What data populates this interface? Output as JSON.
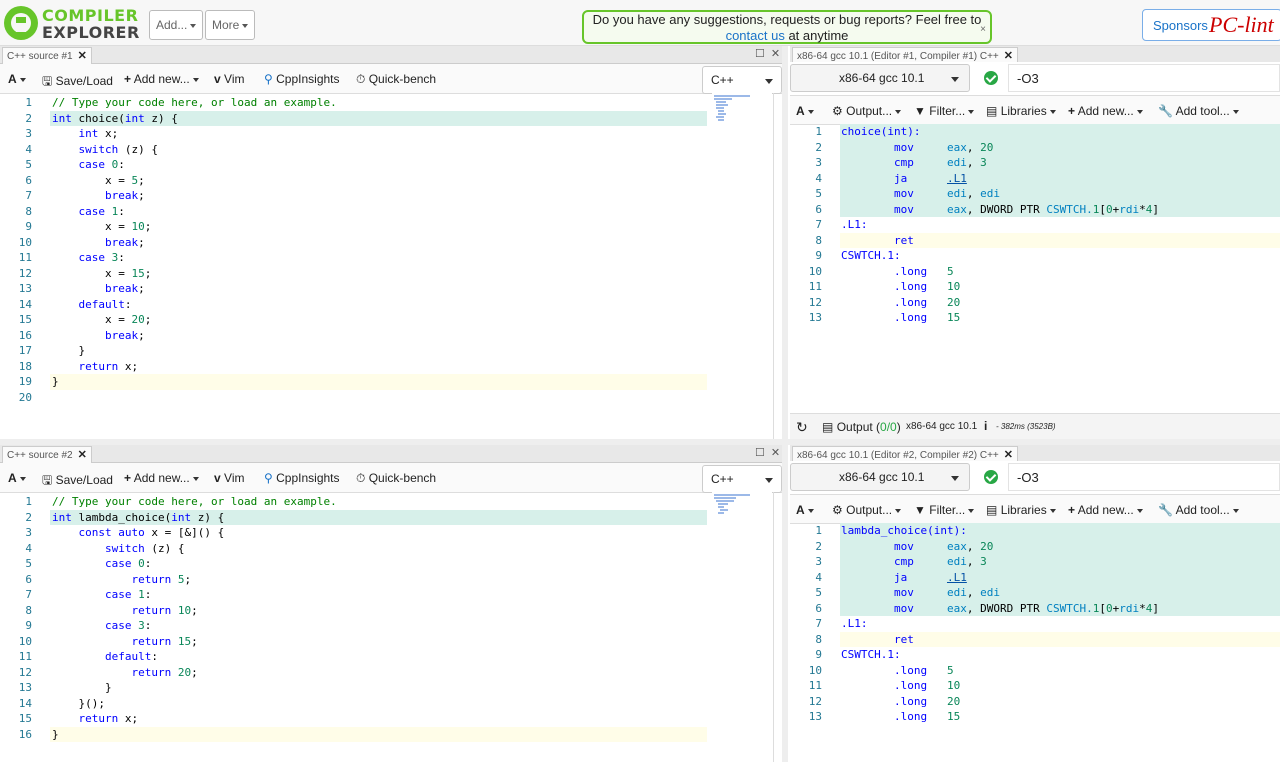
{
  "header": {
    "logo_line1": "COMPILER",
    "logo_line2": "EXPLORER",
    "add_label": "Add...",
    "more_label": "More",
    "banner_text": "Do you have any suggestions, requests or bug reports? Feel free to",
    "banner_link": "contact us",
    "banner_suffix": " at anytime",
    "banner_close": "×",
    "sponsors_label": "Sponsors",
    "sponsor_name": "PC-lint"
  },
  "editor_toolbar": {
    "font_label": "A",
    "save_load": "Save/Load",
    "add_new": "Add new...",
    "vim": "Vim",
    "cppinsights": "CppInsights",
    "quickbench": "Quick-bench",
    "language": "C++"
  },
  "compiler_toolbar": {
    "font_label": "A",
    "output": "Output...",
    "filter": "Filter...",
    "libraries": "Libraries",
    "add_new": "Add new...",
    "add_tool": "Add tool..."
  },
  "editor1": {
    "tab_title": "C++ source #1",
    "lines": [
      "// Type your code here, or load an example.",
      "int choice(int z) {",
      "    int x;",
      "    switch (z) {",
      "    case 0:",
      "        x = 5;",
      "        break;",
      "    case 1:",
      "        x = 10;",
      "        break;",
      "    case 3:",
      "        x = 15;",
      "        break;",
      "    default:",
      "        x = 20;",
      "        break;",
      "    }",
      "    return x;",
      "}",
      ""
    ]
  },
  "editor2": {
    "tab_title": "C++ source #2",
    "lines": [
      "// Type your code here, or load an example.",
      "int lambda_choice(int z) {",
      "    const auto x = [&]() {",
      "        switch (z) {",
      "        case 0:",
      "            return 5;",
      "        case 1:",
      "            return 10;",
      "        case 3:",
      "            return 15;",
      "        default:",
      "            return 20;",
      "        }",
      "    }();",
      "    return x;",
      "}"
    ]
  },
  "compiler1": {
    "tab_title": "x86-64 gcc 10.1 (Editor #1, Compiler #1) C++",
    "compiler_name": "x86-64 gcc 10.1",
    "options": "-O3",
    "asm": [
      "choice(int):",
      "        mov     eax, 20",
      "        cmp     edi, 3",
      "        ja      .L1",
      "        mov     edi, edi",
      "        mov     eax, DWORD PTR CSWTCH.1[0+rdi*4]",
      ".L1:",
      "        ret",
      "CSWTCH.1:",
      "        .long   5",
      "        .long   10",
      "        .long   20",
      "        .long   15"
    ],
    "status_output": "Output (",
    "status_counts": "0/0",
    "status_compiler": "x86-64 gcc 10.1",
    "status_info_icon": "i",
    "status_time": "- 382ms (3523B)"
  },
  "compiler2": {
    "tab_title": "x86-64 gcc 10.1 (Editor #2, Compiler #2) C++",
    "compiler_name": "x86-64 gcc 10.1",
    "options": "-O3",
    "asm": [
      "lambda_choice(int):",
      "        mov     eax, 20",
      "        cmp     edi, 3",
      "        ja      .L1",
      "        mov     edi, edi",
      "        mov     eax, DWORD PTR CSWTCH.1[0+rdi*4]",
      ".L1:",
      "        ret",
      "CSWTCH.1:",
      "        .long   5",
      "        .long   10",
      "        .long   20",
      "        .long   15"
    ]
  },
  "colors": {
    "brand_green": "#67c52a",
    "line_highlight": "#d7f0ea",
    "current_line": "#fffde8",
    "asm_mapped": "#d5eee8"
  }
}
